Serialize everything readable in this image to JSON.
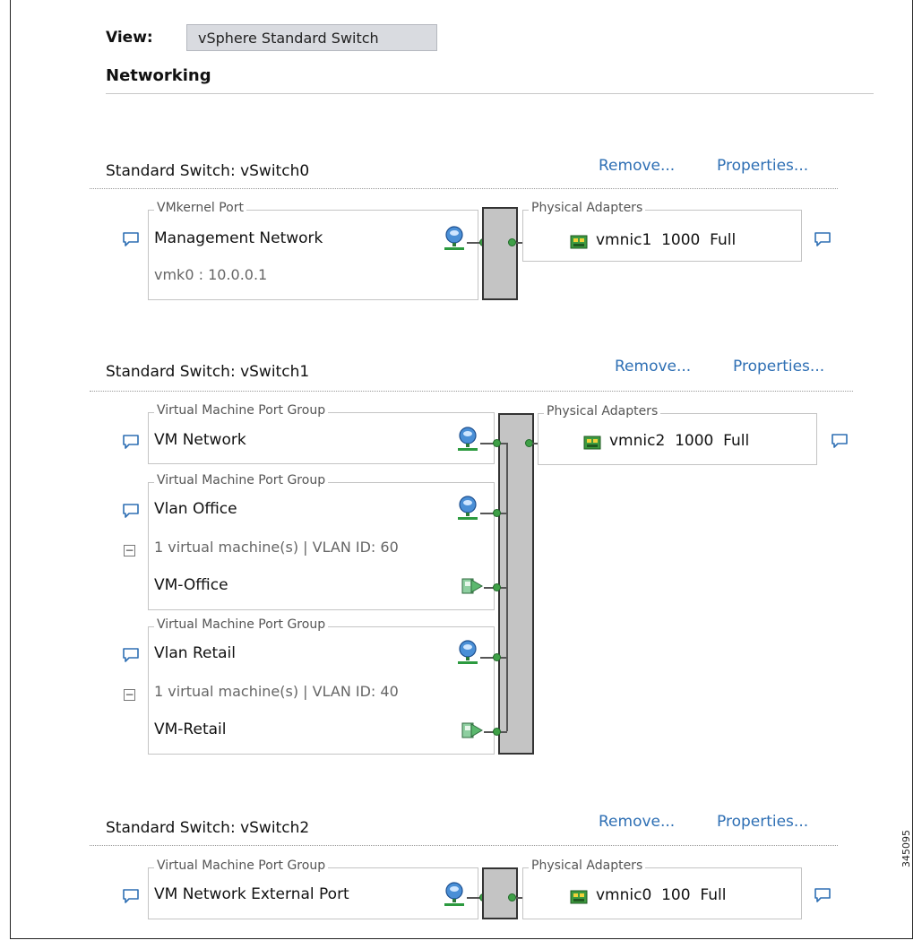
{
  "view": {
    "label": "View:",
    "selected": "vSphere Standard Switch"
  },
  "section_title": "Networking",
  "links": {
    "remove": "Remove...",
    "properties": "Properties..."
  },
  "switches": [
    {
      "title": "Standard Switch: vSwitch0",
      "ports": [
        {
          "group": "VMkernel Port",
          "name": "Management Network",
          "detail": "vmk0 : 10.0.0.1"
        }
      ],
      "adapters_label": "Physical Adapters",
      "adapter": {
        "name": "vmnic1",
        "speed": "1000",
        "duplex": "Full"
      }
    },
    {
      "title": "Standard Switch: vSwitch1",
      "ports": [
        {
          "group": "Virtual Machine Port Group",
          "name": "VM Network"
        },
        {
          "group": "Virtual Machine Port Group",
          "name": "Vlan Office",
          "summary": "1 virtual machine(s) | VLAN ID: 60",
          "vm": "VM-Office"
        },
        {
          "group": "Virtual Machine Port Group",
          "name": "Vlan Retail",
          "summary": "1 virtual machine(s) | VLAN ID: 40",
          "vm": "VM-Retail"
        }
      ],
      "adapters_label": "Physical Adapters",
      "adapter": {
        "name": "vmnic2",
        "speed": "1000",
        "duplex": "Full"
      }
    },
    {
      "title": "Standard Switch: vSwitch2",
      "ports": [
        {
          "group": "Virtual Machine Port Group",
          "name": "VM Network External Port"
        }
      ],
      "adapters_label": "Physical Adapters",
      "adapter": {
        "name": "vmnic0",
        "speed": "100",
        "duplex": "Full"
      }
    }
  ],
  "figure_code": "345095",
  "colors": {
    "link": "#2e6fb4",
    "bar": "#c4c4c4",
    "dot": "#3fa047",
    "select_bg": "#d9dbe0"
  }
}
